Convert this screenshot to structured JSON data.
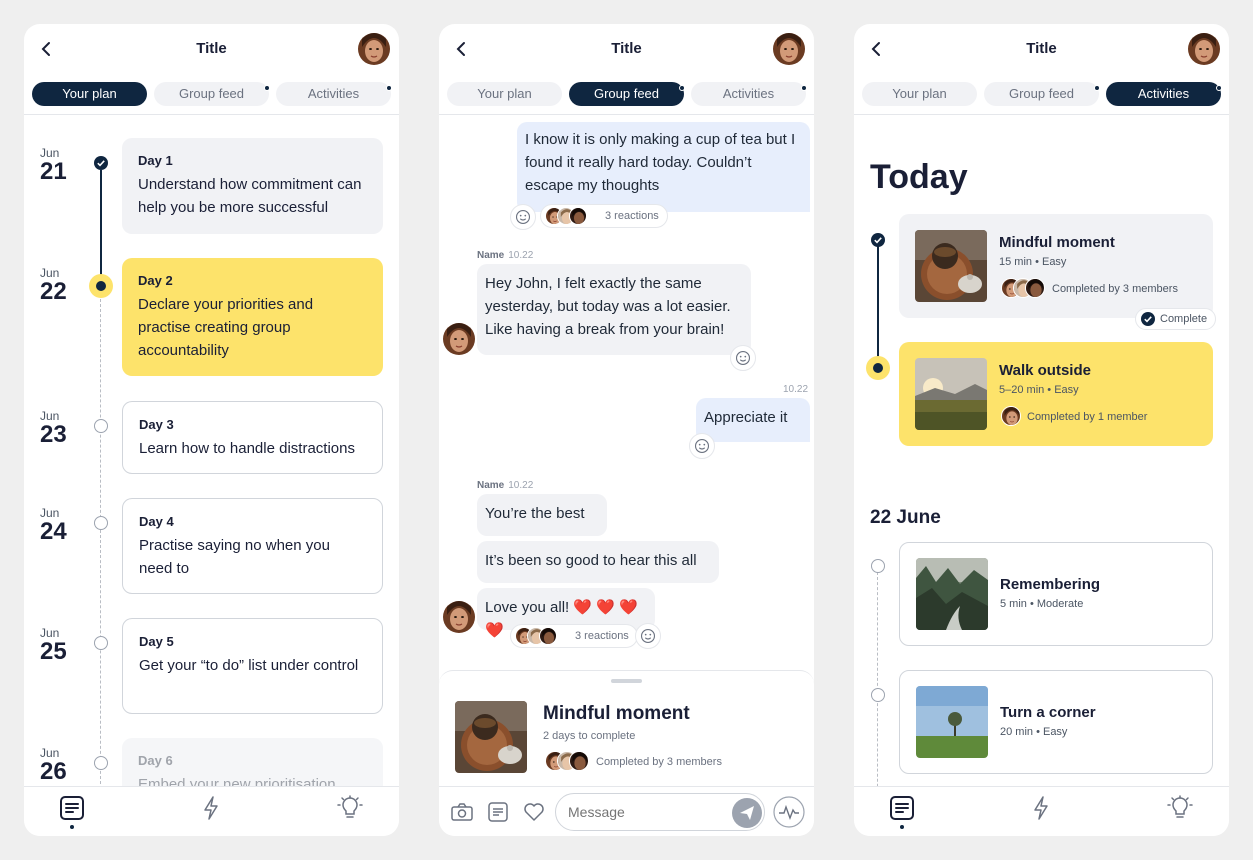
{
  "header": {
    "title": "Title"
  },
  "tabs": [
    "Your plan",
    "Group feed",
    "Activities"
  ],
  "plan": {
    "days": [
      {
        "month": "Jun",
        "date": "21",
        "label": "Day 1",
        "text": "Understand how commitment can help you be more successful",
        "state": "done"
      },
      {
        "month": "Jun",
        "date": "22",
        "label": "Day 2",
        "text": "Declare your priorities and practise creating group accountability",
        "state": "current"
      },
      {
        "month": "Jun",
        "date": "23",
        "label": "Day 3",
        "text": "Learn how to handle distractions",
        "state": "upcoming"
      },
      {
        "month": "Jun",
        "date": "24",
        "label": "Day 4",
        "text": "Practise saying no when you need to",
        "state": "upcoming"
      },
      {
        "month": "Jun",
        "date": "25",
        "label": "Day 5",
        "text": "Get your “to do” list under control",
        "state": "upcoming"
      },
      {
        "month": "Jun",
        "date": "26",
        "label": "Day 6",
        "text": "Embed your new prioritisation",
        "state": "upcoming"
      }
    ]
  },
  "feed": {
    "messages": [
      {
        "text": "I know it is only making a cup of tea but I found it really hard today. Couldn’t escape my thoughts",
        "reactions": "3 reactions"
      },
      {
        "name": "Name",
        "time": "10.22",
        "text": "Hey John, I felt exactly the same yesterday, but today was a lot easier. Like having a break from your brain!"
      },
      {
        "time": "10.22",
        "text": "Appreciate it"
      },
      {
        "name": "Name",
        "time": "10.22",
        "text": "You’re the best"
      },
      {
        "text": "It’s been so good to hear this all"
      },
      {
        "text": "Love you all! ❤️ ❤️ ❤️ ❤️",
        "reactions": "3 reactions"
      }
    ],
    "sheet": {
      "title": "Mindful moment",
      "due": "2 days to complete",
      "completed": "Completed by 3 members"
    },
    "composer": {
      "placeholder": "Message"
    }
  },
  "activities": {
    "today_heading": "Today",
    "today": [
      {
        "name": "Mindful moment",
        "meta": "15 min • Easy",
        "completed": "Completed by 3 members",
        "status": "Complete"
      },
      {
        "name": "Walk outside",
        "meta": "5–20 min • Easy",
        "completed": "Completed by 1 member"
      }
    ],
    "upcoming_heading": "22 June",
    "upcoming": [
      {
        "name": "Remembering",
        "meta": "5 min • Moderate"
      },
      {
        "name": "Turn a corner",
        "meta": "20 min • Easy"
      }
    ]
  },
  "bottom_nav": [
    "plan-icon",
    "lightning-icon",
    "lightbulb-icon"
  ],
  "colors": {
    "navy": "#0f2640",
    "yellow": "#fde36b",
    "card_grey": "#f1f2f5",
    "bubble_blue": "#e7eefc"
  }
}
